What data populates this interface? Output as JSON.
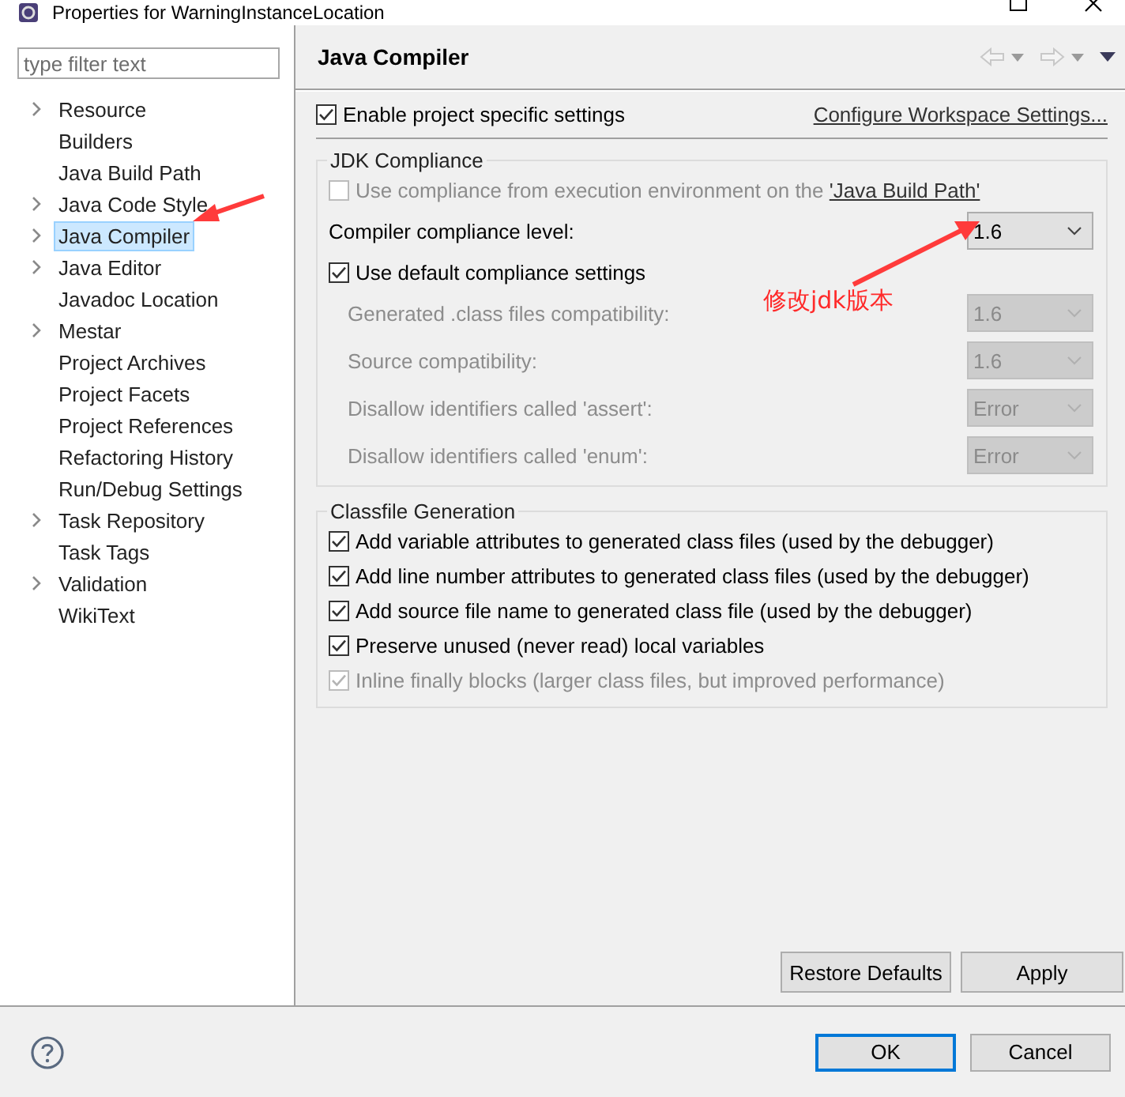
{
  "window": {
    "title": "Properties for WarningInstanceLocation"
  },
  "filter": {
    "placeholder": "type filter text"
  },
  "tree": [
    {
      "label": "Resource",
      "expandable": true,
      "selected": false
    },
    {
      "label": "Builders",
      "expandable": false,
      "selected": false
    },
    {
      "label": "Java Build Path",
      "expandable": false,
      "selected": false
    },
    {
      "label": "Java Code Style",
      "expandable": true,
      "selected": false
    },
    {
      "label": "Java Compiler",
      "expandable": true,
      "selected": true
    },
    {
      "label": "Java Editor",
      "expandable": true,
      "selected": false
    },
    {
      "label": "Javadoc Location",
      "expandable": false,
      "selected": false
    },
    {
      "label": "Mestar",
      "expandable": true,
      "selected": false
    },
    {
      "label": "Project Archives",
      "expandable": false,
      "selected": false
    },
    {
      "label": "Project Facets",
      "expandable": false,
      "selected": false
    },
    {
      "label": "Project References",
      "expandable": false,
      "selected": false
    },
    {
      "label": "Refactoring History",
      "expandable": false,
      "selected": false
    },
    {
      "label": "Run/Debug Settings",
      "expandable": false,
      "selected": false
    },
    {
      "label": "Task Repository",
      "expandable": true,
      "selected": false
    },
    {
      "label": "Task Tags",
      "expandable": false,
      "selected": false
    },
    {
      "label": "Validation",
      "expandable": true,
      "selected": false
    },
    {
      "label": "WikiText",
      "expandable": false,
      "selected": false
    }
  ],
  "page": {
    "title": "Java Compiler"
  },
  "enable": {
    "label": "Enable project specific settings",
    "checked": true
  },
  "workspace_link": "Configure Workspace Settings...",
  "jdk_group": {
    "title": "JDK Compliance",
    "use_env": {
      "label": "Use compliance from execution environment on the ",
      "link": "'Java Build Path'",
      "checked": false,
      "disabled": true
    },
    "level": {
      "label": "Compiler compliance level:",
      "value": "1.6",
      "disabled": false
    },
    "use_default": {
      "label": "Use default compliance settings",
      "checked": true
    },
    "settings": [
      {
        "label": "Generated .class files compatibility:",
        "value": "1.6",
        "disabled": true
      },
      {
        "label": "Source compatibility:",
        "value": "1.6",
        "disabled": true
      },
      {
        "label": "Disallow identifiers called 'assert':",
        "value": "Error",
        "disabled": true
      },
      {
        "label": "Disallow identifiers called 'enum':",
        "value": "Error",
        "disabled": true
      }
    ]
  },
  "classfile_group": {
    "title": "Classfile Generation",
    "options": [
      {
        "label": "Add variable attributes to generated class files (used by the debugger)",
        "checked": true,
        "disabled": false
      },
      {
        "label": "Add line number attributes to generated class files (used by the debugger)",
        "checked": true,
        "disabled": false
      },
      {
        "label": "Add source file name to generated class file (used by the debugger)",
        "checked": true,
        "disabled": false
      },
      {
        "label": "Preserve unused (never read) local variables",
        "checked": true,
        "disabled": false
      },
      {
        "label": "Inline finally blocks (larger class files, but improved performance)",
        "checked": true,
        "disabled": true
      }
    ]
  },
  "page_buttons": [
    "Restore Defaults",
    "Apply"
  ],
  "dialog_buttons": [
    {
      "label": "OK",
      "selected": true
    },
    {
      "label": "Cancel",
      "selected": false
    }
  ],
  "annotation": "修改jdk版本"
}
